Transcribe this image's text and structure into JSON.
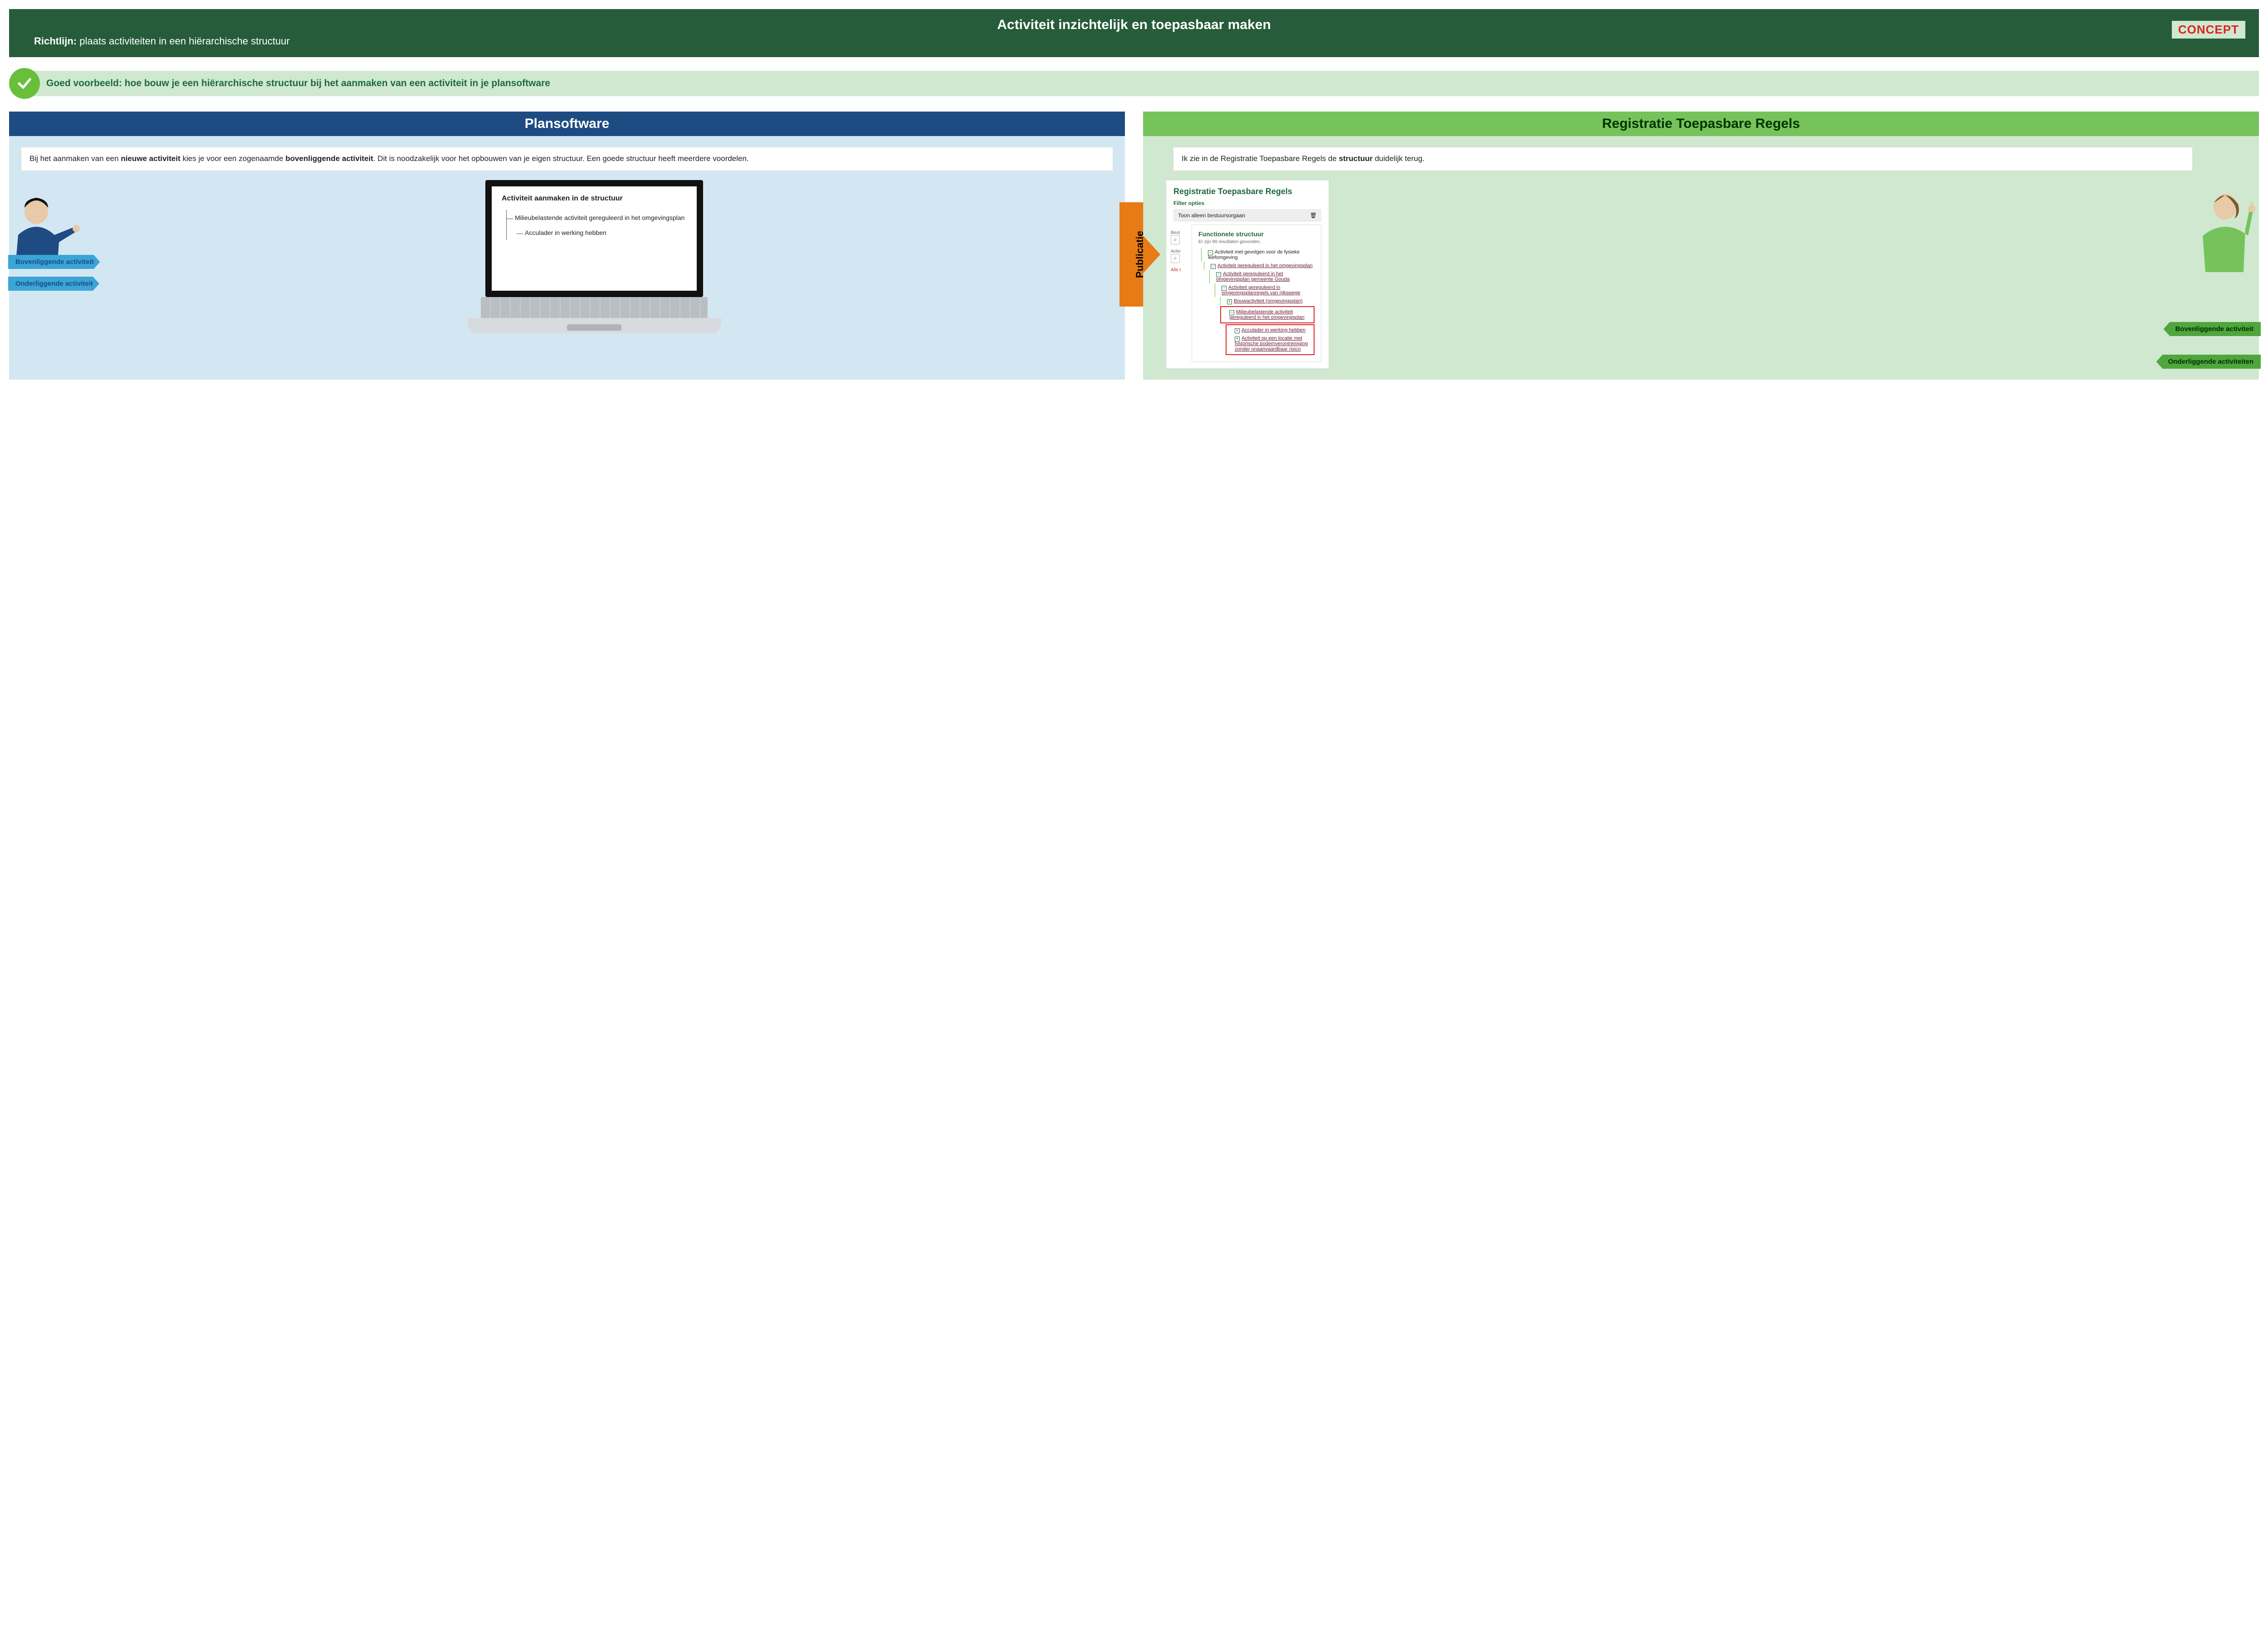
{
  "header": {
    "title": "Activiteit inzichtelijk en toepasbaar maken",
    "guideline_label": "Richtlijn:",
    "guideline_text": "plaats activiteiten in een hiërarchische structuur",
    "concept": "CONCEPT"
  },
  "good_example": "Goed voorbeeld: hoe bouw je een hiërarchische structuur bij het aanmaken van een activiteit in je plansoftware",
  "left": {
    "panel_title": "Plansoftware",
    "speech_parts": {
      "p1": "Bij het aanmaken van een ",
      "b1": "nieuwe activiteit",
      "p2": " kies je voor een zogenaamde ",
      "b2": "bovenliggende activiteit",
      "p3": ". Dit is noodzakelijk voor het opbouwen van je eigen structuur. Een goede structuur heeft meerdere voordelen."
    },
    "screen_title": "Activiteit aanmaken in de structuur",
    "tree": {
      "parent": "Milieubelastende activiteit gereguleerd in het omgevingsplan",
      "child": "Acculader in werking hebben"
    },
    "label_top": "Bovenliggende activiteit",
    "label_bottom": "Onderliggende activiteit"
  },
  "pub_arrow": "Publicatie",
  "right": {
    "panel_title": "Registratie Toepasbare Regels",
    "speech_parts": {
      "p1": "Ik zie in de Registratie Toepasbare Regels de ",
      "b1": "structuur",
      "p2": " duidelijk terug."
    },
    "card_title": "Registratie Toepasbare Regels",
    "filter_title": "Filter opties",
    "filter_option": "Toon alleen bestuursorgaan",
    "sidebar_labels": {
      "best": "Best",
      "activ": "Activ",
      "alle": "Alle t"
    },
    "func_title": "Functionele structuur",
    "results": "Er zijn 90 resultaten gevonden.",
    "tree": {
      "n1": "Activiteit met gevolgen voor de fysieke leefomgeving",
      "n2": "Activiteit gereguleerd in het omgevingsplan",
      "n3": "Activiteit gereguleerd in het omgevingsplan gemeente Gouda",
      "n4": "Activiteit gereguleerd in omgevingsplanregels van rijkswege",
      "n5": "Bouwactiviteit (omgevingsplan)",
      "n6": "Milieubelastende activiteit gereguleerd in het omgevingsplan",
      "n7": "Acculader in werking hebben",
      "n8": "Activiteit op een locatie met historische bodemverontreiniging zonder onaanvaardbaar risico"
    },
    "label_top": "Bovenliggende activiteit",
    "label_bottom": "Onderliggende activiteiten"
  }
}
